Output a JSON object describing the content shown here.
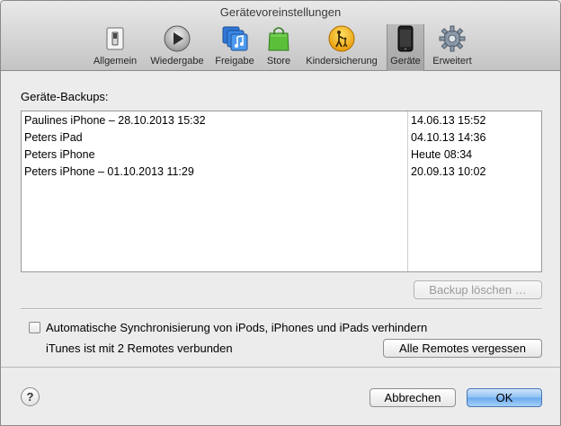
{
  "window": {
    "title": "Gerätevoreinstellungen"
  },
  "toolbar": {
    "items": [
      {
        "label": "Allgemein",
        "icon": "switch-icon"
      },
      {
        "label": "Wiedergabe",
        "icon": "play-icon"
      },
      {
        "label": "Freigabe",
        "icon": "sharing-icon"
      },
      {
        "label": "Store",
        "icon": "shopping-bag-icon"
      },
      {
        "label": "Kindersicherung",
        "icon": "parental-control-icon"
      },
      {
        "label": "Geräte",
        "icon": "iphone-icon",
        "active": true
      },
      {
        "label": "Erweitert",
        "icon": "gear-icon"
      }
    ]
  },
  "backups": {
    "label": "Geräte-Backups:",
    "rows": [
      {
        "name": "Paulines iPhone – 28.10.2013 15:32",
        "date": "14.06.13 15:52"
      },
      {
        "name": "Peters iPad",
        "date": "04.10.13 14:36"
      },
      {
        "name": "Peters iPhone",
        "date": "Heute 08:34"
      },
      {
        "name": "Peters iPhone – 01.10.2013 11:29",
        "date": "20.09.13 10:02"
      }
    ],
    "delete_button": "Backup löschen …"
  },
  "sync": {
    "checkbox_label": "Automatische Synchronisierung von iPods, iPhones und iPads verhindern",
    "checked": false
  },
  "remotes": {
    "status": "iTunes ist mit 2 Remotes verbunden",
    "forget_button": "Alle Remotes vergessen"
  },
  "footer": {
    "help": "?",
    "cancel": "Abbrechen",
    "ok": "OK"
  }
}
